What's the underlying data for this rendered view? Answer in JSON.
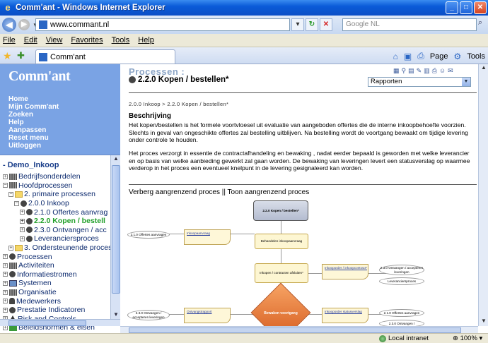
{
  "window": {
    "title": "Comm'ant - Windows Internet Explorer"
  },
  "browser": {
    "address": "www.commant.nl",
    "search_placeholder": "Google NL",
    "menu": [
      "File",
      "Edit",
      "View",
      "Favorites",
      "Tools",
      "Help"
    ],
    "tab_label": "Comm'ant",
    "page_label": "Page",
    "tools_label": "Tools"
  },
  "sidebar": {
    "logo": "Comm'ant",
    "nav": [
      "Home",
      "Mijn Comm'ant",
      "Zoeken",
      "Help",
      "Aanpassen",
      "Reset menu",
      "Uitloggen"
    ],
    "tree_root": "- Demo_Inkoop",
    "tree": [
      {
        "label": "Bedrijfsonderdelen",
        "icon": "grid-icon"
      },
      {
        "label": "Hoofdprocessen",
        "icon": "grid-icon"
      },
      {
        "label": "2. primaire processen",
        "icon": "folder-icon"
      },
      {
        "label": "2.0.0 Inkoop",
        "icon": "gear-icon"
      },
      {
        "label": "2.1.0 Offertes aanvrag",
        "icon": "gear-icon"
      },
      {
        "label": "2.2.0 Kopen / bestell",
        "icon": "gear-icon"
      },
      {
        "label": "2.3.0 Ontvangen / acc",
        "icon": "gear-icon"
      },
      {
        "label": "Leveranciersproces",
        "icon": "gear-icon"
      },
      {
        "label": "3. Ondersteunende proces",
        "icon": "folder-icon"
      },
      {
        "label": "Processen",
        "icon": "gear-icon"
      },
      {
        "label": "Activiteiten",
        "icon": "grid-icon"
      },
      {
        "label": "Informatiestromen",
        "icon": "flow-icon"
      },
      {
        "label": "Systemen",
        "icon": "monitor-icon"
      },
      {
        "label": "Organisatie",
        "icon": "grid-icon"
      },
      {
        "label": "Medewerkers",
        "icon": "people-icon"
      },
      {
        "label": "Prestatie Indicatoren",
        "icon": "gauge-icon"
      },
      {
        "label": "Risk and Controls",
        "icon": "warning-icon"
      },
      {
        "label": "Beleidsnormen & eisen",
        "icon": "check-icon"
      }
    ]
  },
  "main": {
    "heading": "Processen :",
    "subheading": "2.2.0 Kopen / bestellen*",
    "dropdown": "Rapporten",
    "breadcrumb": "2.0.0 Inkoop > 2.2.0 Kopen / bestellen*",
    "section_title": "Beschrijving",
    "para1": "Het kopen/bestellen is het formele voortvloesel uit evaluatie van aangeboden offertes die de interne inkoopbehoefte voorzien. Slechts in geval van ongeschikte offertes zal bestelling uitblijven. Na bestelling wordt de voortgang bewaakt om tijdige levering onder controle te houden.",
    "para2": "Het proces verzorgt in essentie de contractafhandeling en bewaking , nadat eerder bepaald is geworden met welke leverancier en op basis van welke aanbieding gewerkt zal gaan worden. De bewaking van leveringen levert een statusverslag op waarmee verderop in het proces een eventueel knelpunt in de levering gesignaleerd kan worden.",
    "toggle_text": "Verberg aangrenzend proces || Toon aangrenzend proces"
  },
  "diagram": {
    "top": "2.2.0 Kopen / bestellen*",
    "in1": "2.1.0 Offertes aanvragen",
    "doc1": "Inkoopaanvraag",
    "step1": "Behandelen inkoopaanvraag",
    "step2": "Inkopen / contracten afsluiten*",
    "doc2": "Inkooporder / inkoopcontract*",
    "out1": "2.3.0 Ontvangen / accepteren leveringen",
    "out2": "Leveranciersproces",
    "in2": "2.3.0 Ontvangen / accepteren leveringen",
    "doc3": "Ontvangstrapport",
    "decision": "Bewaken voortgang",
    "doc4": "Inkooporder statusverslag",
    "out3": "2.1.0 Offertes aanvragen",
    "out4": "2.3.0 Ontvangen /"
  },
  "status": {
    "zone": "Local intranet",
    "zoom": "100%"
  }
}
